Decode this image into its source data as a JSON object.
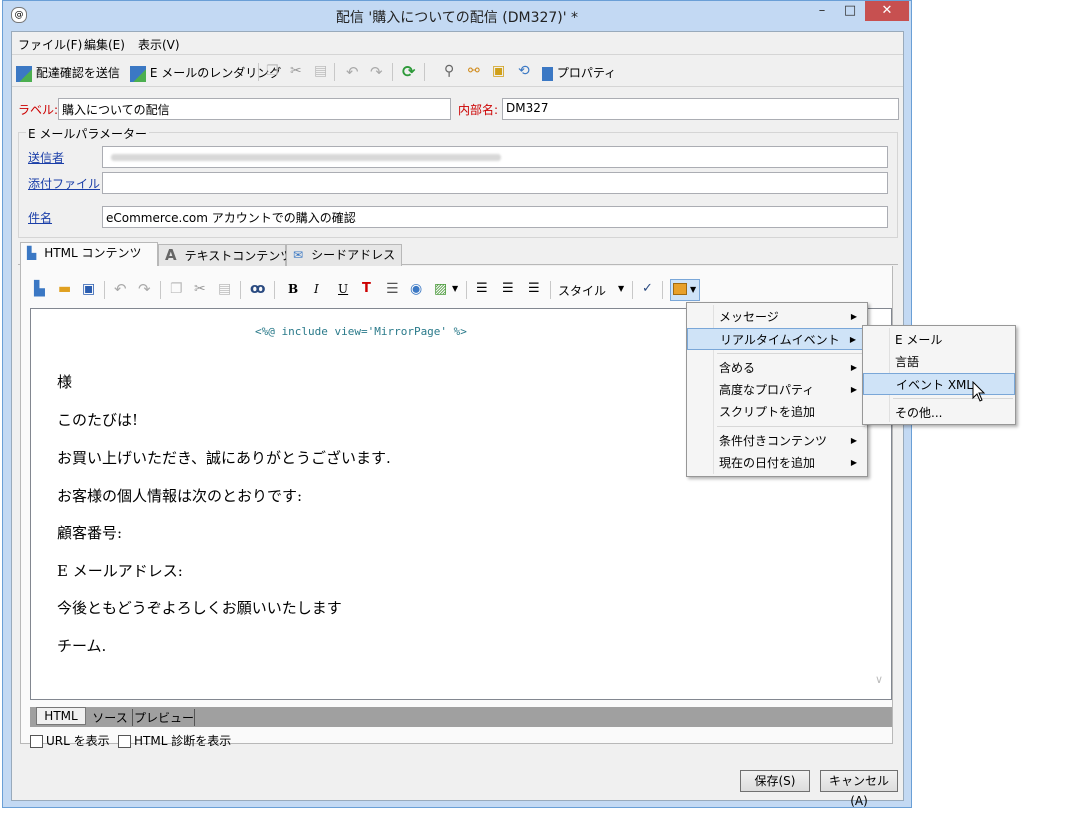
{
  "window": {
    "title": "配信 '購入についての配信 (DM327)' *",
    "minimize": "–",
    "maximize": "□",
    "close": "✕"
  },
  "menubar": {
    "items": [
      "ファイル(F)",
      "編集(E)",
      "表示(V)"
    ]
  },
  "toolbar": {
    "send_proof": "配達確認を送信",
    "email_rendering": "E メールのレンダリング",
    "properties": "プロパティ"
  },
  "form": {
    "label_caption": "ラベル:",
    "label_value": "購入についての配信",
    "internal_name_caption": "内部名:",
    "internal_name_value": "DM327",
    "email_params_legend": "E メールパラメーター",
    "sender_link": "送信者",
    "sender_value": "",
    "attachment_link": "添付ファイル",
    "attachment_value": "",
    "subject_link": "件名",
    "subject_value": "eCommerce.com アカウントでの購入の確認"
  },
  "tabs": [
    "HTML コンテンツ",
    "テキストコンテンツ",
    "シードアドレス"
  ],
  "editor_toolbar": {
    "bold": "B",
    "italic": "I",
    "underline": "U",
    "style": "スタイル"
  },
  "editor": {
    "include_line": "<%@ include view='MirrorPage' %>",
    "lines": [
      "様",
      "このたびは!",
      "お買い上げいただき、誠にありがとうございます.",
      "お客様の個人情報は次のとおりです:",
      "顧客番号:",
      "E メールアドレス:",
      "今後ともどうぞよろしくお願いいたします",
      "チーム."
    ]
  },
  "bottom_tabs": [
    "HTML",
    "ソース",
    "プレビュー"
  ],
  "checkboxes": {
    "show_url": "URL を表示",
    "show_html_diag": "HTML 診断を表示"
  },
  "buttons": {
    "save": "保存(S)",
    "cancel": "キャンセル(A)"
  },
  "context_menu": {
    "items": [
      "メッセージ",
      "リアルタイムイベント",
      "含める",
      "高度なプロパティ",
      "スクリプトを追加",
      "条件付きコンテンツ",
      "現在の日付を追加"
    ]
  },
  "submenu": {
    "items": [
      "E メール",
      "言語",
      "イベント XML",
      "その他..."
    ]
  },
  "colors": {
    "accent": "#c3d9f3",
    "link": "#1a3ea8",
    "label_red": "#cc0000",
    "highlight": "#cfe3f7"
  }
}
